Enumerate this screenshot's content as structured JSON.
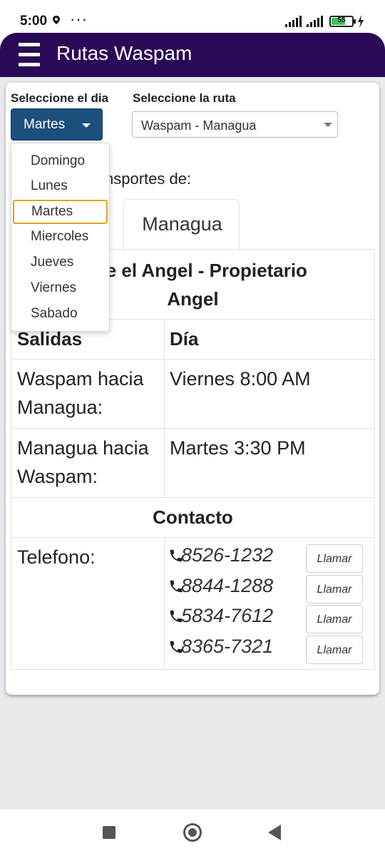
{
  "status_bar": {
    "time": "5:00",
    "dots": "···",
    "battery": "55",
    "icons": [
      "location-pin-icon",
      "signal-icon",
      "battery-icon",
      "charging-icon"
    ]
  },
  "app_bar": {
    "title": "Rutas Waspam",
    "color": "#2a0a57",
    "icons": [
      "menu-icon"
    ]
  },
  "filters": {
    "day_label": "Seleccione el dia",
    "day_selected": "Martes",
    "route_label": "Seleccione la ruta",
    "route_selected": "Waspam - Managua",
    "button_color": "#1d4f7c"
  },
  "day_dropdown": {
    "options": [
      "Domingo",
      "Lunes",
      "Martes",
      "Miercoles",
      "Jueves",
      "Viernes",
      "Sabado"
    ],
    "highlighted": "Martes",
    "highlight_color": "#e3a11c"
  },
  "content": {
    "heading_visible": "nsportes de:",
    "tab_label": "Managua",
    "company_line1": "orte el Angel - Propietario",
    "company_line2": "Angel",
    "schedule_header": {
      "col1": "Salidas",
      "col2": "Día"
    },
    "schedule_rows": [
      {
        "route_line1": "Waspam hacia",
        "route_line2": "Managua:",
        "time": "Viernes 8:00 AM"
      },
      {
        "route_line1": "Managua hacia",
        "route_line2": "Waspam:",
        "time": "Martes 3:30 PM"
      }
    ],
    "contact_header": "Contacto",
    "phone_label": "Telefono:",
    "phones": [
      "8526-1232",
      "8844-1288",
      "5834-7612",
      "8365-7321"
    ],
    "call_label": "Llamar",
    "icons": [
      "phone-icon"
    ]
  },
  "nav_bar": {
    "icons": [
      "recent-apps-icon",
      "home-icon",
      "back-icon"
    ]
  }
}
